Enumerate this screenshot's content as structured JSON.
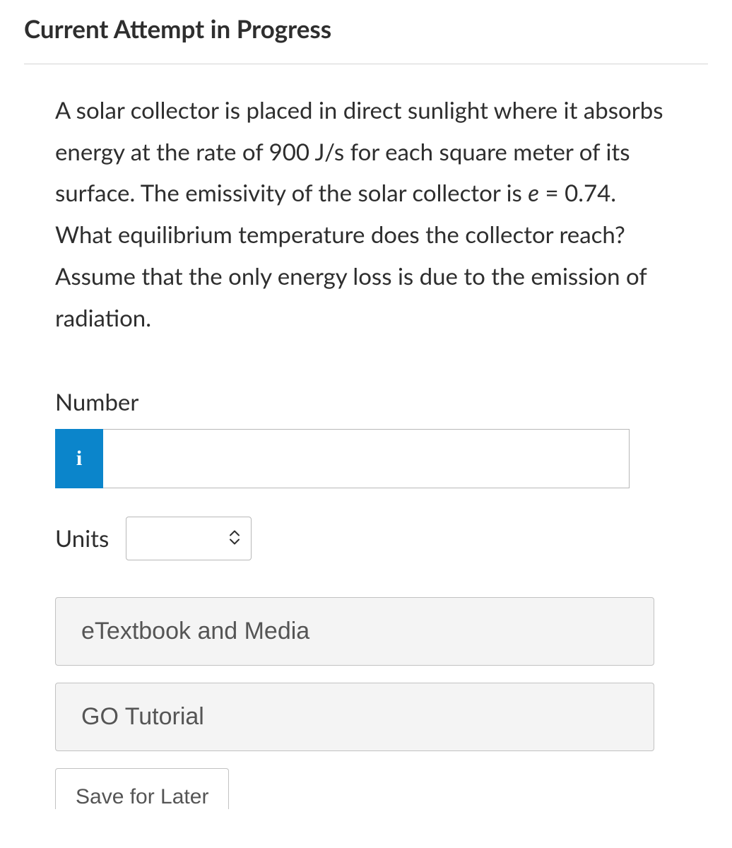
{
  "heading": "Current Attempt in Progress",
  "question": {
    "part1": "A solar collector is placed in direct sunlight where it absorbs energy at the rate of 900 J/s for each square meter of its surface. The emissivity of the solar collector is ",
    "var": "e",
    "part2": " = 0.74. What equilibrium temperature does the collector reach? Assume that the only energy loss is due to the emission of radiation."
  },
  "labels": {
    "number": "Number",
    "units": "Units",
    "info": "i"
  },
  "inputs": {
    "number_value": "",
    "units_value": ""
  },
  "buttons": {
    "etextbook": "eTextbook and Media",
    "gotutorial": "GO Tutorial",
    "save": "Save for Later"
  }
}
